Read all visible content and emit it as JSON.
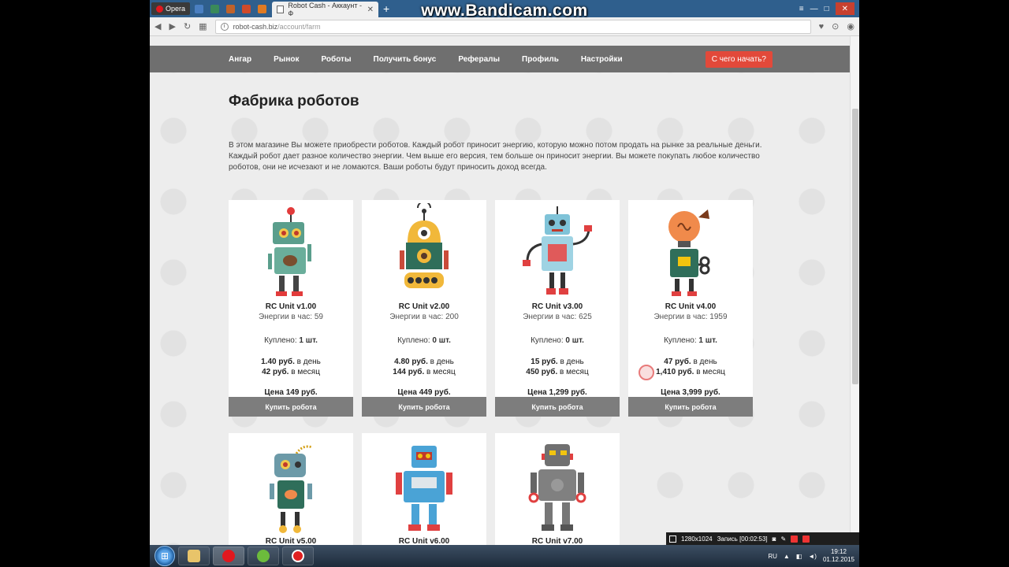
{
  "browser": {
    "opera_label": "Opera",
    "active_tab_title": "Robot Cash - Аккаунт - Ф",
    "url_domain": "robot-cash.biz",
    "url_path": "/account/farm"
  },
  "watermark": "www.Bandicam.com",
  "nav": {
    "items": [
      "Ангар",
      "Рынок",
      "Роботы",
      "Получить бонус",
      "Рефералы",
      "Профиль",
      "Настройки"
    ],
    "start_button": "С чего начать?"
  },
  "page": {
    "title": "Фабрика роботов",
    "intro": "В этом магазине Вы можете приобрести роботов. Каждый робот приносит энергию, которую можно потом продать на рынке за реальные деньги. Каждый робот дает разное количество энергии. Чем выше его версия, тем больше он приносит энергии. Вы можете покупать любое количество роботов, они не исчезают и не ломаются. Ваши роботы будут приносить доход всегда."
  },
  "robots": [
    {
      "name": "RC Unit v1.00",
      "energy": "Энергии в час: 59",
      "bought_label": "Куплено:",
      "bought": "1 шт.",
      "day_value": "1.40 руб.",
      "day_label": "в день",
      "month_value": "42 руб.",
      "month_label": "в месяц",
      "price": "Цена 149 руб.",
      "buy": "Купить робота",
      "color": "#5a9e8c"
    },
    {
      "name": "RC Unit v2.00",
      "energy": "Энергии в час: 200",
      "bought_label": "Куплено:",
      "bought": "0 шт.",
      "day_value": "4.80 руб.",
      "day_label": "в день",
      "month_value": "144 руб.",
      "month_label": "в месяц",
      "price": "Цена 449 руб.",
      "buy": "Купить робота",
      "color": "#f1b83a"
    },
    {
      "name": "RC Unit v3.00",
      "energy": "Энергии в час: 625",
      "bought_label": "Куплено:",
      "bought": "0 шт.",
      "day_value": "15 руб.",
      "day_label": "в день",
      "month_value": "450 руб.",
      "month_label": "в месяц",
      "price": "Цена 1,299 руб.",
      "buy": "Купить робота",
      "color": "#7fc3d8"
    },
    {
      "name": "RC Unit v4.00",
      "energy": "Энергии в час: 1959",
      "bought_label": "Куплено:",
      "bought": "1 шт.",
      "day_value": "47 руб.",
      "day_label": "в день",
      "month_value": "1,410 руб.",
      "month_label": "в месяц",
      "price": "Цена 3,999 руб.",
      "buy": "Купить робота",
      "color": "#f08a4b"
    },
    {
      "name": "RC Unit v5.00",
      "color": "#6c9aa8"
    },
    {
      "name": "RC Unit v6.00",
      "color": "#4aa3d6"
    },
    {
      "name": "RC Unit v7.00",
      "color": "#707070"
    }
  ],
  "recorder": {
    "resolution": "1280x1024",
    "recording": "Запись [00:02:53]"
  },
  "taskbar": {
    "lang": "RU",
    "time": "19:12",
    "date": "01.12.2015"
  }
}
